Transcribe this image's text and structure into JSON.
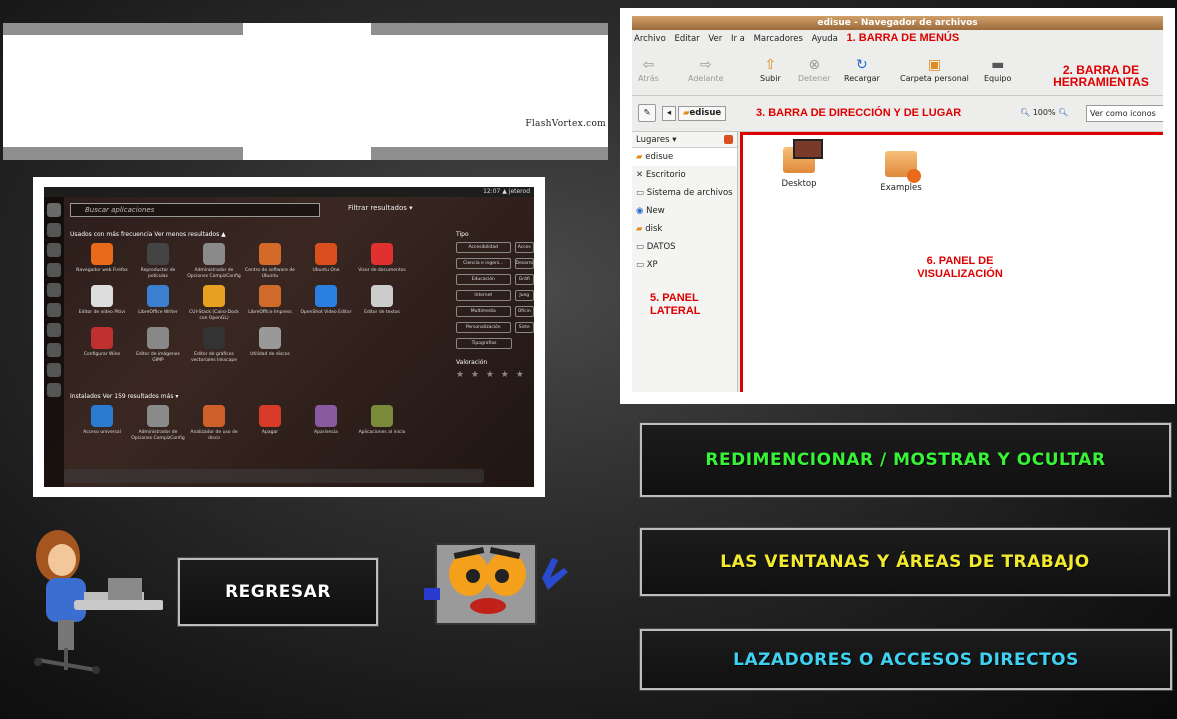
{
  "flash_banner": {
    "watermark": "FlashVortex.com"
  },
  "ubuntu_dash": {
    "top_status": "12:07 ▲ jeterod",
    "search_placeholder": "Buscar aplicaciones",
    "filter_label": "Filtrar resultados ▾",
    "section_frequent": "Usados con más frecuencia  Ver menos resultados ▲",
    "section_installed": "Instalados  Ver 159 resultados más ▾",
    "frequent_apps": [
      {
        "label": "Navegador web Firefox",
        "color": "#e86a1a"
      },
      {
        "label": "Reproductor de películas",
        "color": "#444"
      },
      {
        "label": "Administrador de Opciones CompizConfig",
        "color": "#8a8a8a"
      },
      {
        "label": "Centro de software de Ubuntu",
        "color": "#d46a2a"
      },
      {
        "label": "Ubuntu One",
        "color": "#d9501e"
      },
      {
        "label": "Visor de documentos",
        "color": "#e03030"
      },
      {
        "label": "Editor de vídeo Pitivi",
        "color": "#ddd"
      },
      {
        "label": "LibreOffice Writer",
        "color": "#3b7fd1"
      },
      {
        "label": "CUI-Stack (Cairo-Dock con OpenGL)",
        "color": "#e8a020"
      },
      {
        "label": "LibreOffice Impress",
        "color": "#d06a2a"
      },
      {
        "label": "OpenShot Video Editor",
        "color": "#2a7fe0"
      },
      {
        "label": "Editor de textos",
        "color": "#ccc"
      },
      {
        "label": "Configurar Wine",
        "color": "#c03030"
      },
      {
        "label": "Editor de imágenes GIMP",
        "color": "#888"
      },
      {
        "label": "Editor de gráficos vectoriales Inkscape",
        "color": "#333"
      },
      {
        "label": "Utilidad de discos",
        "color": "#999"
      }
    ],
    "installed_apps": [
      {
        "label": "Acceso universal",
        "color": "#2a7ad0"
      },
      {
        "label": "Administrador de Opciones CompizConfig",
        "color": "#8a8a8a"
      },
      {
        "label": "Analizador de uso de disco",
        "color": "#d0602a"
      },
      {
        "label": "Apagar",
        "color": "#d83a2a"
      },
      {
        "label": "Apariencia",
        "color": "#8a5aa0"
      },
      {
        "label": "Aplicaciones al inicio",
        "color": "#7a8a3a"
      }
    ],
    "filters_title": "Tipo",
    "filters": [
      "Accesibilidad",
      "Acces",
      "Ciencia e ingeni...",
      "Desarro",
      "Educación",
      "Gráfi",
      "Internet",
      "Jueg",
      "Multimedia",
      "Oficin",
      "Personalización",
      "Siste",
      "Tipografías"
    ],
    "rating_title": "Valoración",
    "rating_stars": "★ ★ ★ ★ ★"
  },
  "nautilus": {
    "title": "edisue - Navegador de archivos",
    "menus": [
      "Archivo",
      "Editar",
      "Ver",
      "Ir a",
      "Marcadores",
      "Ayuda"
    ],
    "label_menubar": "1. BARRA DE MENÚS",
    "label_toolbar": "2. BARRA DE HERRAMIENTAS",
    "toolbar": {
      "back": "Atrás",
      "forward": "Adelante",
      "up": "Subir",
      "stop": "Detener",
      "reload": "Recargar",
      "home": "Carpeta personal",
      "computer": "Equipo"
    },
    "location_crumb": "edisue",
    "label_locbar": "3. BARRA DE DIRECCIÓN Y DE LUGAR",
    "zoom": "100%",
    "view_as": "Ver como iconos",
    "side_title": "Lugares ▾",
    "side_items": [
      "edisue",
      "Escritorio",
      "Sistema de archivos",
      "New",
      "disk",
      "DATOS",
      "XP"
    ],
    "label_side": "5. PANEL LATERAL",
    "label_view": "6. PANEL DE VISUALIZACIÓN",
    "folders": [
      "Desktop",
      "Examples"
    ]
  },
  "buttons": {
    "redim": "REDIMENCIONAR / MOSTRAR Y OCULTAR",
    "ventanas": "LAS VENTANAS Y ÁREAS DE TRABAJO",
    "lazadores": "LAZADORES O ACCESOS DIRECTOS",
    "regresar": "REGRESAR"
  }
}
